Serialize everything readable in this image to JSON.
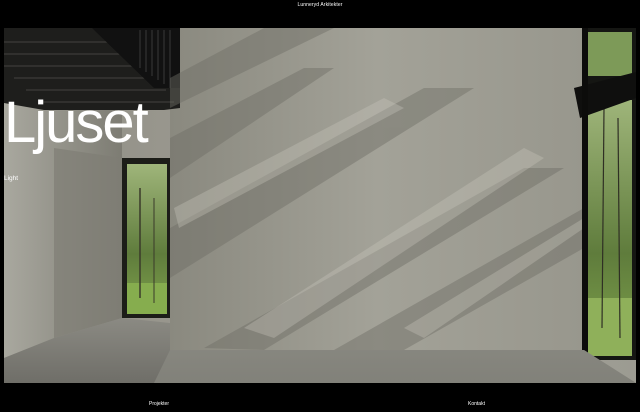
{
  "header": {
    "brand": "Lunneryd Arkitekter"
  },
  "hero": {
    "title": "Ljuset",
    "subtitle": "Light"
  },
  "nav": {
    "projects_label": "Projekter",
    "contact_label": "Kontakt"
  },
  "colors": {
    "background": "#000000",
    "text": "#ffffff",
    "concrete": "#9c9b92",
    "foliage": "#6e8f4a"
  }
}
